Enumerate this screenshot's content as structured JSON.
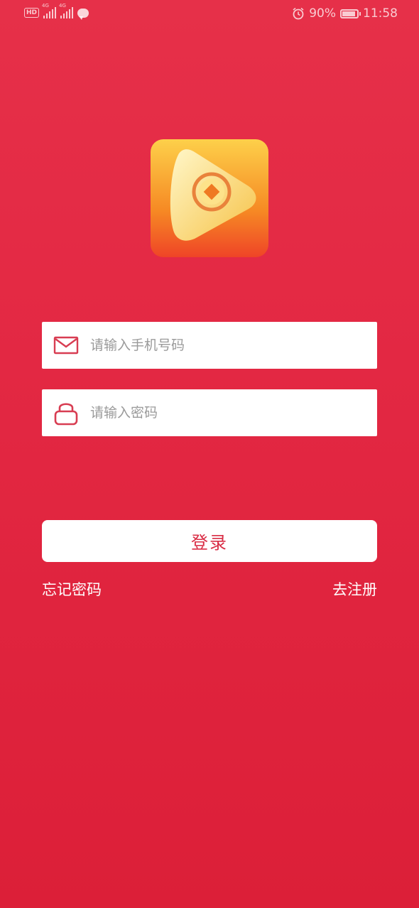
{
  "status_bar": {
    "hd_badge": "HD",
    "network_1": "4G",
    "network_2": "4G",
    "battery": "90%",
    "time": "11:58"
  },
  "logo_icon": "play-coin-logo",
  "form": {
    "phone": {
      "placeholder": "请输入手机号码",
      "value": "",
      "icon": "mail-icon"
    },
    "password": {
      "placeholder": "请输入密码",
      "value": "",
      "icon": "lock-icon"
    }
  },
  "actions": {
    "login": "登录",
    "forgot_password": "忘记密码",
    "register": "去注册"
  },
  "colors": {
    "background": "#e32843",
    "accent": "#d92c44",
    "logo_top": "#fdd04a",
    "logo_bottom": "#ef4427"
  }
}
